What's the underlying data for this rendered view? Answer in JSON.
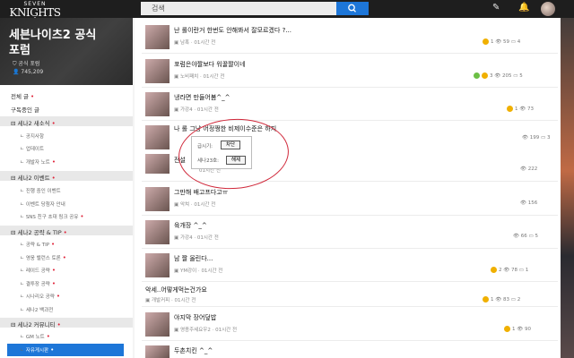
{
  "logo": {
    "line1": "SEVEN",
    "line2": "KNIGHTS",
    "line3": "II"
  },
  "search": {
    "value": "검색"
  },
  "header": {
    "icons": [
      "pencil-icon",
      "bell-icon",
      "avatar"
    ]
  },
  "community": {
    "title_l1": "세븐나이츠2 공식",
    "title_l2": "포럼",
    "official_label": "공식 포럼",
    "members": "745,209"
  },
  "sidebar": {
    "all": "전체 글",
    "subscribed": "구독중인 글",
    "groups": [
      {
        "label": "세나2 새소식",
        "items": [
          "공지사항",
          "업데이트",
          "개발자 노트"
        ]
      },
      {
        "label": "세나2 이벤트",
        "items": [
          "진행 중인 이벤트",
          "이벤트 당첨자 안내",
          "SNS 친구 초대 링크 공유"
        ]
      },
      {
        "label": "세나2 공략 & TIP",
        "items": [
          "공략 & TIP",
          "영웅 밸런스 토론",
          "레이드 공략",
          "결투장 공략",
          "시나리오 공략",
          "세나2 백과전"
        ]
      },
      {
        "label": "세나2 커뮤니티",
        "items": [
          "GM 노트",
          "자유게시판"
        ]
      }
    ]
  },
  "posts": [
    {
      "title": "난 롤이란거 한번도 안해봐서 잘모르겠다 ?...",
      "author": "남혹",
      "time": "01시간 전",
      "views": "59",
      "comments": "4",
      "badge": "1"
    },
    {
      "title": "포럼은야짤보다 워꿀짤이네",
      "author": "노비패치",
      "time": "01시간 전",
      "views": "205",
      "comments": "5",
      "badge": "3"
    },
    {
      "title": "냉라면 만들어봄^_^",
      "author": "가강4",
      "time": "01시간 전",
      "views": "73",
      "comments": "",
      "badge": "1"
    },
    {
      "title": "나 롤 그냥 어정쩡한 비제이수준은 하지",
      "author": "",
      "time": "",
      "views": "199",
      "comments": "3",
      "badge": ""
    },
    {
      "title": "전설",
      "author": "",
      "time": "01시간 전",
      "views": "222",
      "comments": "",
      "badge": ""
    },
    {
      "title": "그만해 배고프다고ㅠ",
      "author": "악쳐",
      "time": "01시간 전",
      "views": "156",
      "comments": "",
      "badge": ""
    },
    {
      "title": "육개장 ^_^",
      "author": "가강4",
      "time": "01시간 전",
      "views": "66",
      "comments": "5",
      "badge": ""
    },
    {
      "title": "남 짤 올린다...",
      "author": "YM강이",
      "time": "01시간 전",
      "views": "78",
      "comments": "1",
      "badge": "2"
    },
    {
      "title": "악세..어떻게먹는건가요",
      "author": "개발커피",
      "time": "01시간 전",
      "views": "83",
      "comments": "2",
      "badge": "1"
    },
    {
      "title": "야지막 장어덮밥",
      "author": "영종주세요우2",
      "time": "01시간 전",
      "views": "90",
      "comments": "",
      "badge": "1"
    },
    {
      "title": "두촌치킨 ^_^",
      "author": "",
      "time": "",
      "views": "",
      "comments": "",
      "badge": ""
    }
  ],
  "popup": {
    "row1_label": "급시기:",
    "row1_btn": "차단",
    "row2_label": "세나23호:",
    "row2_btn": "해제"
  }
}
